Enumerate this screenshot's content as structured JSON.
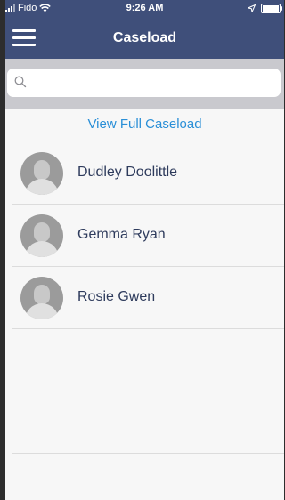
{
  "status_bar": {
    "carrier": "Fido",
    "time": "9:26 AM"
  },
  "navbar": {
    "title": "Caseload"
  },
  "search": {
    "placeholder": ""
  },
  "view_full_caseload": "View Full Caseload",
  "clients": [
    {
      "name": "Dudley Doolittle"
    },
    {
      "name": "Gemma Ryan"
    },
    {
      "name": "Rosie Gwen"
    }
  ],
  "colors": {
    "header": "#3f4f7a",
    "link": "#2a8fd7",
    "name_text": "#2e3b5c"
  }
}
